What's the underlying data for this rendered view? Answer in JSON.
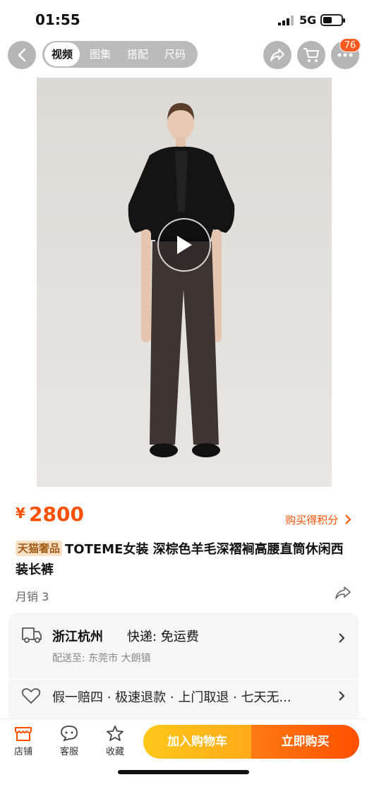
{
  "status_bar": {
    "time": "01:55",
    "network": "5G"
  },
  "nav": {
    "tabs": [
      "视频",
      "图集",
      "搭配",
      "尺码"
    ],
    "active_tab": "视频",
    "cart_badge": "76"
  },
  "product": {
    "currency": "¥",
    "price": "2800",
    "points_link": "购买得积分",
    "tag": "天猫奢品",
    "title": "TOTEME女装 深棕色羊毛深褶裥高腰直筒休闲西装长裤",
    "sales": "月销 3"
  },
  "delivery": {
    "origin": "浙江杭州",
    "shipping": "快递: 免运费",
    "address": "配送至: 东莞市 大朗镇",
    "guarantee": "假一赔四 · 极速退款 · 上门取退 · 七天无..."
  },
  "bottom_bar": {
    "store": "店铺",
    "service": "客服",
    "favorite": "收藏",
    "add_to_cart": "加入购物车",
    "buy_now": "立即购买"
  },
  "colors": {
    "accent": "#ff5000",
    "cart_button": "#ffb818",
    "tag_bg": "#f8e0c4"
  },
  "icons": [
    "back-icon",
    "share-icon",
    "cart-icon",
    "more-icon",
    "play-icon",
    "truck-icon",
    "heart-shield-icon",
    "store-icon",
    "service-icon",
    "star-icon",
    "chevron-right-icon"
  ]
}
